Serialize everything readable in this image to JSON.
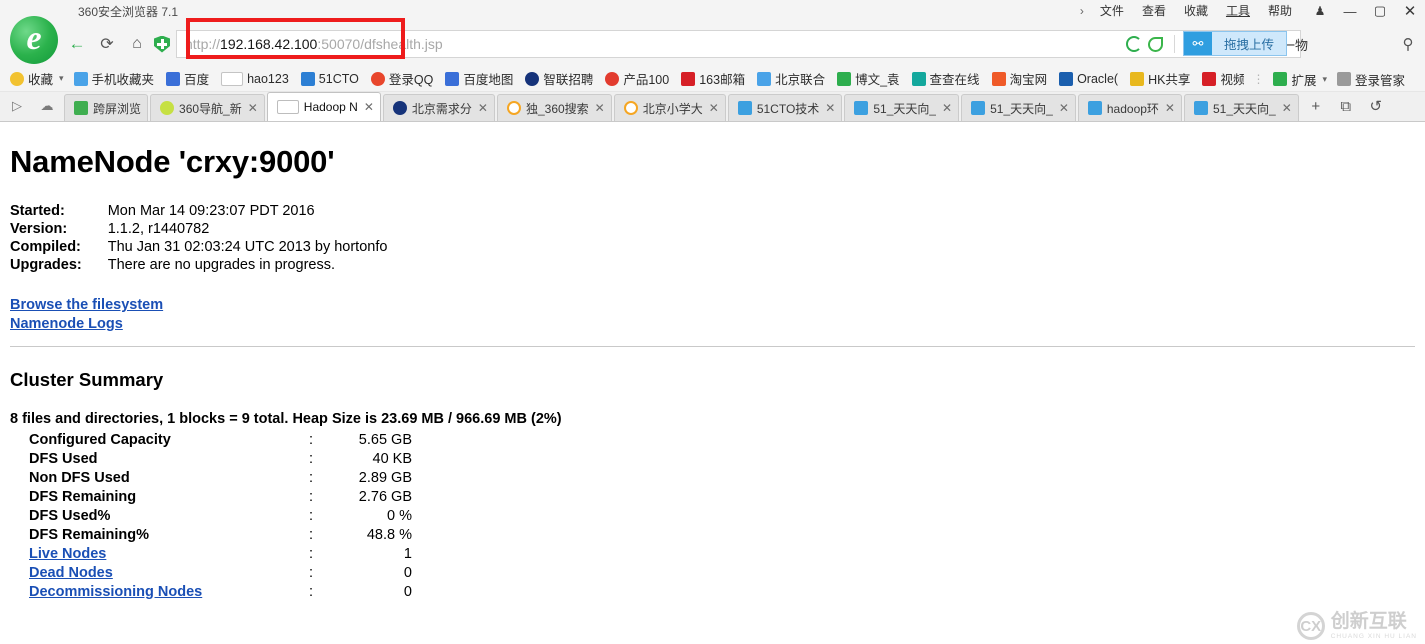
{
  "window": {
    "app_title": "360安全浏览器 7.1",
    "menu_chevron": "›",
    "menu_items": [
      {
        "label": "文件",
        "underlined": false
      },
      {
        "label": "查看",
        "underlined": false
      },
      {
        "label": "收藏",
        "underlined": false
      },
      {
        "label": "工具",
        "underlined": true
      },
      {
        "label": "帮助",
        "underlined": false
      }
    ],
    "controls": {
      "skin": "♟",
      "minimize": "—",
      "maximize": "▢",
      "close": "✕"
    }
  },
  "nav": {
    "back": "←",
    "reload": "⟳",
    "home": "⌂",
    "url": {
      "scheme": "http://",
      "host": "192.168.42.100",
      "port": ":50070",
      "tail": "/dfshealth.jsp"
    },
    "search_text": "蒸米饭加一物",
    "search_glass": "⚲",
    "drag_upload": {
      "icon": "⚯",
      "label": "拖拽上传"
    },
    "chevron": "⌄"
  },
  "bookmarks": {
    "favorites_label": "收藏",
    "caret": "▾",
    "items": [
      {
        "label": "手机收藏夹",
        "fav": "ltblue"
      },
      {
        "label": "百度",
        "fav": "paw"
      },
      {
        "label": "hao123",
        "fav": "page"
      },
      {
        "label": "51CTO",
        "fav": "blue"
      },
      {
        "label": "登录QQ",
        "fav": "qq"
      },
      {
        "label": "百度地图",
        "fav": "paw"
      },
      {
        "label": "智联招聘",
        "fav": "navy"
      },
      {
        "label": "产品100",
        "fav": "red"
      },
      {
        "label": "163邮箱",
        "fav": "crimson"
      },
      {
        "label": "北京联合",
        "fav": "ltblue"
      },
      {
        "label": "博文_袁",
        "fav": "green"
      },
      {
        "label": "查查在线",
        "fav": "teal"
      },
      {
        "label": "淘宝网",
        "fav": "orange"
      },
      {
        "label": "Oracle(",
        "fav": "dblue"
      },
      {
        "label": "HK共享",
        "fav": "yellow"
      },
      {
        "label": "视频专辑",
        "fav": "crimson"
      }
    ],
    "more": "»",
    "extensions_label": "扩展",
    "login_manager_label": "登录管家"
  },
  "tabs": {
    "left_icons": [
      "play-icon",
      "cloud-icon"
    ],
    "items": [
      {
        "label": "跨屏浏览",
        "fav": "green",
        "active": false,
        "closable": false
      },
      {
        "label": "360导航_新",
        "fav": "lime",
        "active": false,
        "closable": true
      },
      {
        "label": "Hadoop N",
        "fav": "page",
        "active": true,
        "closable": true
      },
      {
        "label": "北京需求分",
        "fav": "navy",
        "active": false,
        "closable": true
      },
      {
        "label": "独_360搜索",
        "fav": "amber",
        "active": false,
        "closable": true
      },
      {
        "label": "北京小学大",
        "fav": "amber",
        "active": false,
        "closable": true
      },
      {
        "label": "51CTO技术",
        "fav": "blue",
        "active": false,
        "closable": true
      },
      {
        "label": "51_天天向_",
        "fav": "blue",
        "active": false,
        "closable": true
      },
      {
        "label": "51_天天向_",
        "fav": "blue",
        "active": false,
        "closable": true
      },
      {
        "label": "hadoop环",
        "fav": "blue",
        "active": false,
        "closable": true
      },
      {
        "label": "51_天天向_",
        "fav": "blue",
        "active": false,
        "closable": true
      }
    ],
    "new_tab": "+",
    "restore_tab": "⧉",
    "undo_tab": "↺"
  },
  "content": {
    "title": "NameNode 'crxy:9000'",
    "info_rows": [
      {
        "key": "Started:",
        "value": "Mon Mar 14 09:23:07 PDT 2016"
      },
      {
        "key": "Version:",
        "value": "1.1.2, r1440782"
      },
      {
        "key": "Compiled:",
        "value": "Thu Jan 31 02:03:24 UTC 2013 by hortonfo"
      },
      {
        "key": "Upgrades:",
        "value": "There are no upgrades in progress."
      }
    ],
    "links": [
      "Browse the filesystem",
      "Namenode Logs"
    ],
    "cluster_heading": "Cluster Summary",
    "summary_line": "8 files and directories, 1 blocks = 9 total. Heap Size is 23.69 MB / 966.69 MB (2%)",
    "stats": [
      {
        "label": "Configured Capacity",
        "sep": ":",
        "value": "5.65 GB",
        "link": false
      },
      {
        "label": "DFS Used",
        "sep": ":",
        "value": "40 KB",
        "link": false
      },
      {
        "label": "Non DFS Used",
        "sep": ":",
        "value": "2.89 GB",
        "link": false
      },
      {
        "label": "DFS Remaining",
        "sep": ":",
        "value": "2.76 GB",
        "link": false
      },
      {
        "label": "DFS Used%",
        "sep": ":",
        "value": "0 %",
        "link": false
      },
      {
        "label": "DFS Remaining%",
        "sep": ":",
        "value": "48.8 %",
        "link": false
      },
      {
        "label": "Live Nodes",
        "sep": ":",
        "value": "1",
        "link": true
      },
      {
        "label": "Dead Nodes",
        "sep": ":",
        "value": "0",
        "link": true
      },
      {
        "label": "Decommissioning Nodes",
        "sep": ":",
        "value": "0",
        "link": true
      }
    ],
    "watermark": {
      "mark": "CX",
      "cn": "创新互联",
      "en": "CHUANG XIN HU LIAN"
    }
  }
}
